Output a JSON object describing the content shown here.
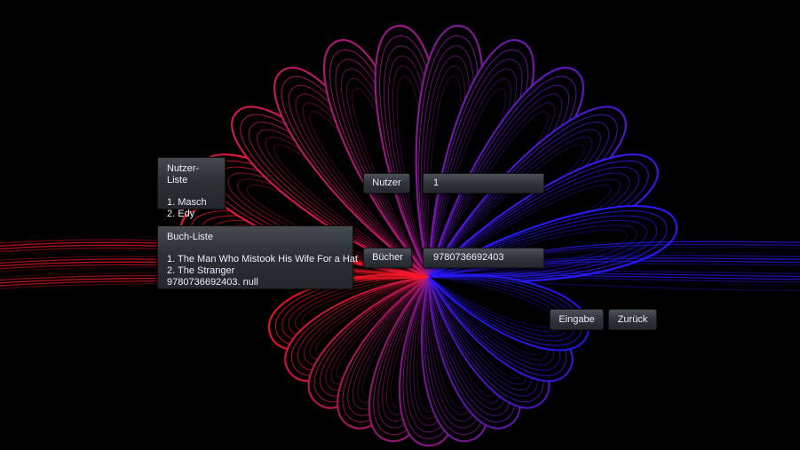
{
  "users_panel": {
    "title": "Nutzer-Liste",
    "items": [
      "1. Masch",
      "2. Edy"
    ]
  },
  "books_panel": {
    "title": "Buch-Liste",
    "items": [
      "1. The Man Who Mistook His Wife For a Hat",
      "2. The Stranger",
      "9780736692403. null"
    ]
  },
  "user_row": {
    "button_label": "Nutzer",
    "field_value": "1"
  },
  "book_row": {
    "button_label": "Bücher",
    "field_value": "9780736692403"
  },
  "actions": {
    "submit_label": "Eingabe",
    "back_label": "Zurück"
  },
  "colors": {
    "petal_red": "#ff1a2a",
    "petal_blue": "#2a1aff",
    "background": "#000000"
  }
}
